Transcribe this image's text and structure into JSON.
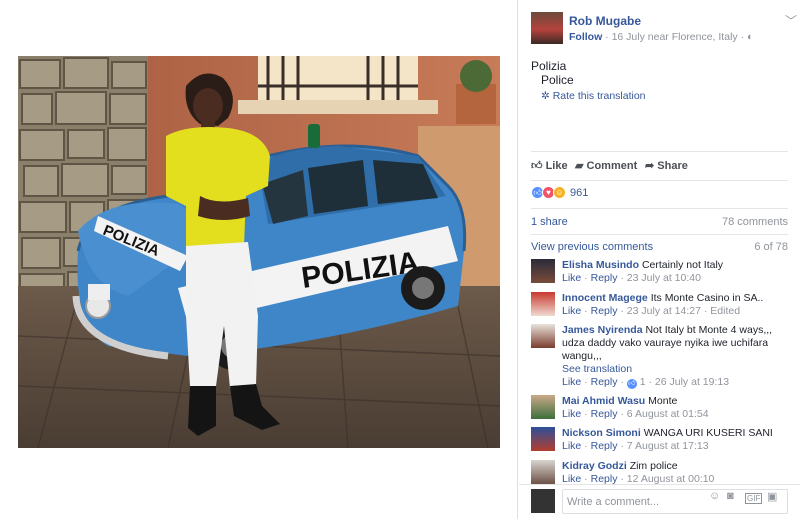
{
  "photo": {
    "car_text_side": "POLIZIA",
    "car_text_hood": "POLIZIA"
  },
  "post": {
    "author": "Rob Mugabe",
    "follow_label": "Follow",
    "meta": "· 16 July near Florence, Italy ·",
    "text": "Polizia",
    "translation": "Police",
    "rate_label": "Rate this translation"
  },
  "actions": {
    "like": "Like",
    "comment": "Comment",
    "share": "Share"
  },
  "reactions": {
    "count": "961",
    "like_icon": "thumbs-up",
    "love_icon": "heart",
    "haha_icon": "laughing-face"
  },
  "stats": {
    "shares": "1 share",
    "comments": "78 comments"
  },
  "comments_header": {
    "prev": "View previous comments",
    "position": "6 of 78"
  },
  "comments": [
    {
      "author": "Elisha Musindo",
      "text": "Certainly not Italy",
      "like": "Like",
      "reply": "Reply",
      "meta": "· 23 July at 10:40"
    },
    {
      "author": "Innocent Magege",
      "text": "Its Monte Casino in SA..",
      "like": "Like",
      "reply": "Reply",
      "meta": "· 23 July at 14:27 · Edited"
    },
    {
      "author": "James Nyirenda",
      "text": "Not Italy bt Monte 4 ways,,, udza daddy vako vauraye nyika iwe uchifara wangu,,,",
      "see_translation": "See translation",
      "like": "Like",
      "reply": "Reply",
      "reacts": "1",
      "meta": "· 26 July at 19:13"
    },
    {
      "author": "Mai Ahmid Wasu",
      "text": "Monte",
      "like": "Like",
      "reply": "Reply",
      "meta": "· 6 August at 01:54"
    },
    {
      "author": "Nickson Simoni",
      "text": "WANGA URI KUSERI SANI",
      "like": "Like",
      "reply": "Reply",
      "meta": "· 7 August at 17:13"
    },
    {
      "author": "Kidray Godzi",
      "text": "Zim police",
      "like": "Like",
      "reply": "Reply",
      "meta": "· 12 August at 00:10"
    }
  ],
  "write": {
    "placeholder": "Write a comment..."
  },
  "colors": {
    "link": "#365899",
    "muted": "#90949c",
    "text": "#1d2129",
    "like_blue": "#5890ff",
    "love_red": "#f25268",
    "haha_yellow": "#f7b125"
  }
}
